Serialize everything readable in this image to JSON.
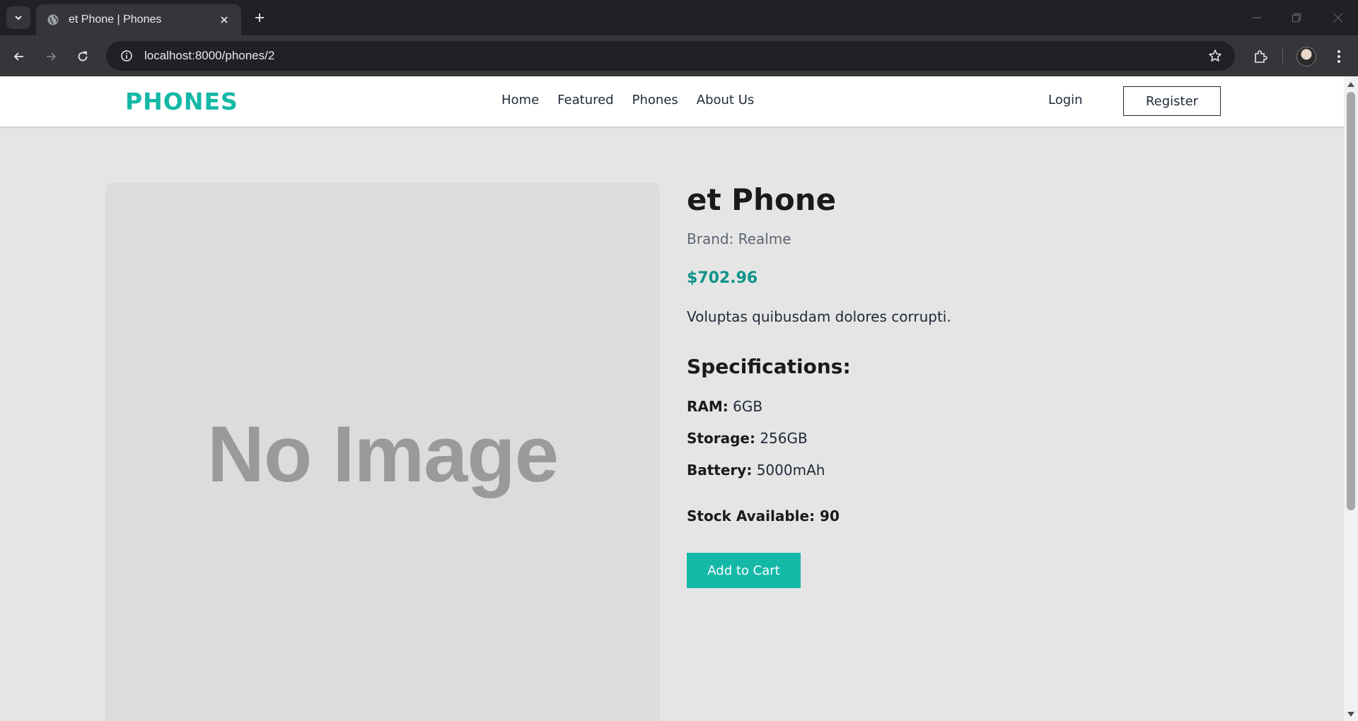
{
  "browser": {
    "tab_title": "et Phone | Phones",
    "url": "localhost:8000/phones/2"
  },
  "header": {
    "logo": "PHONES",
    "nav": [
      "Home",
      "Featured",
      "Phones",
      "About Us"
    ],
    "login": "Login",
    "register": "Register"
  },
  "product": {
    "image_placeholder": "No Image",
    "name": "et Phone",
    "brand": "Brand: Realme",
    "price": "$702.96",
    "description": "Voluptas quibusdam dolores corrupti.",
    "specs_heading": "Specifications:",
    "specs": [
      {
        "label": "RAM:",
        "value": "6GB"
      },
      {
        "label": "Storage:",
        "value": "256GB"
      },
      {
        "label": "Battery:",
        "value": "5000mAh"
      }
    ],
    "stock": "Stock Available: 90",
    "add_to_cart": "Add to Cart"
  },
  "colors": {
    "accent": "#14b8a6",
    "price": "#0f9488"
  }
}
